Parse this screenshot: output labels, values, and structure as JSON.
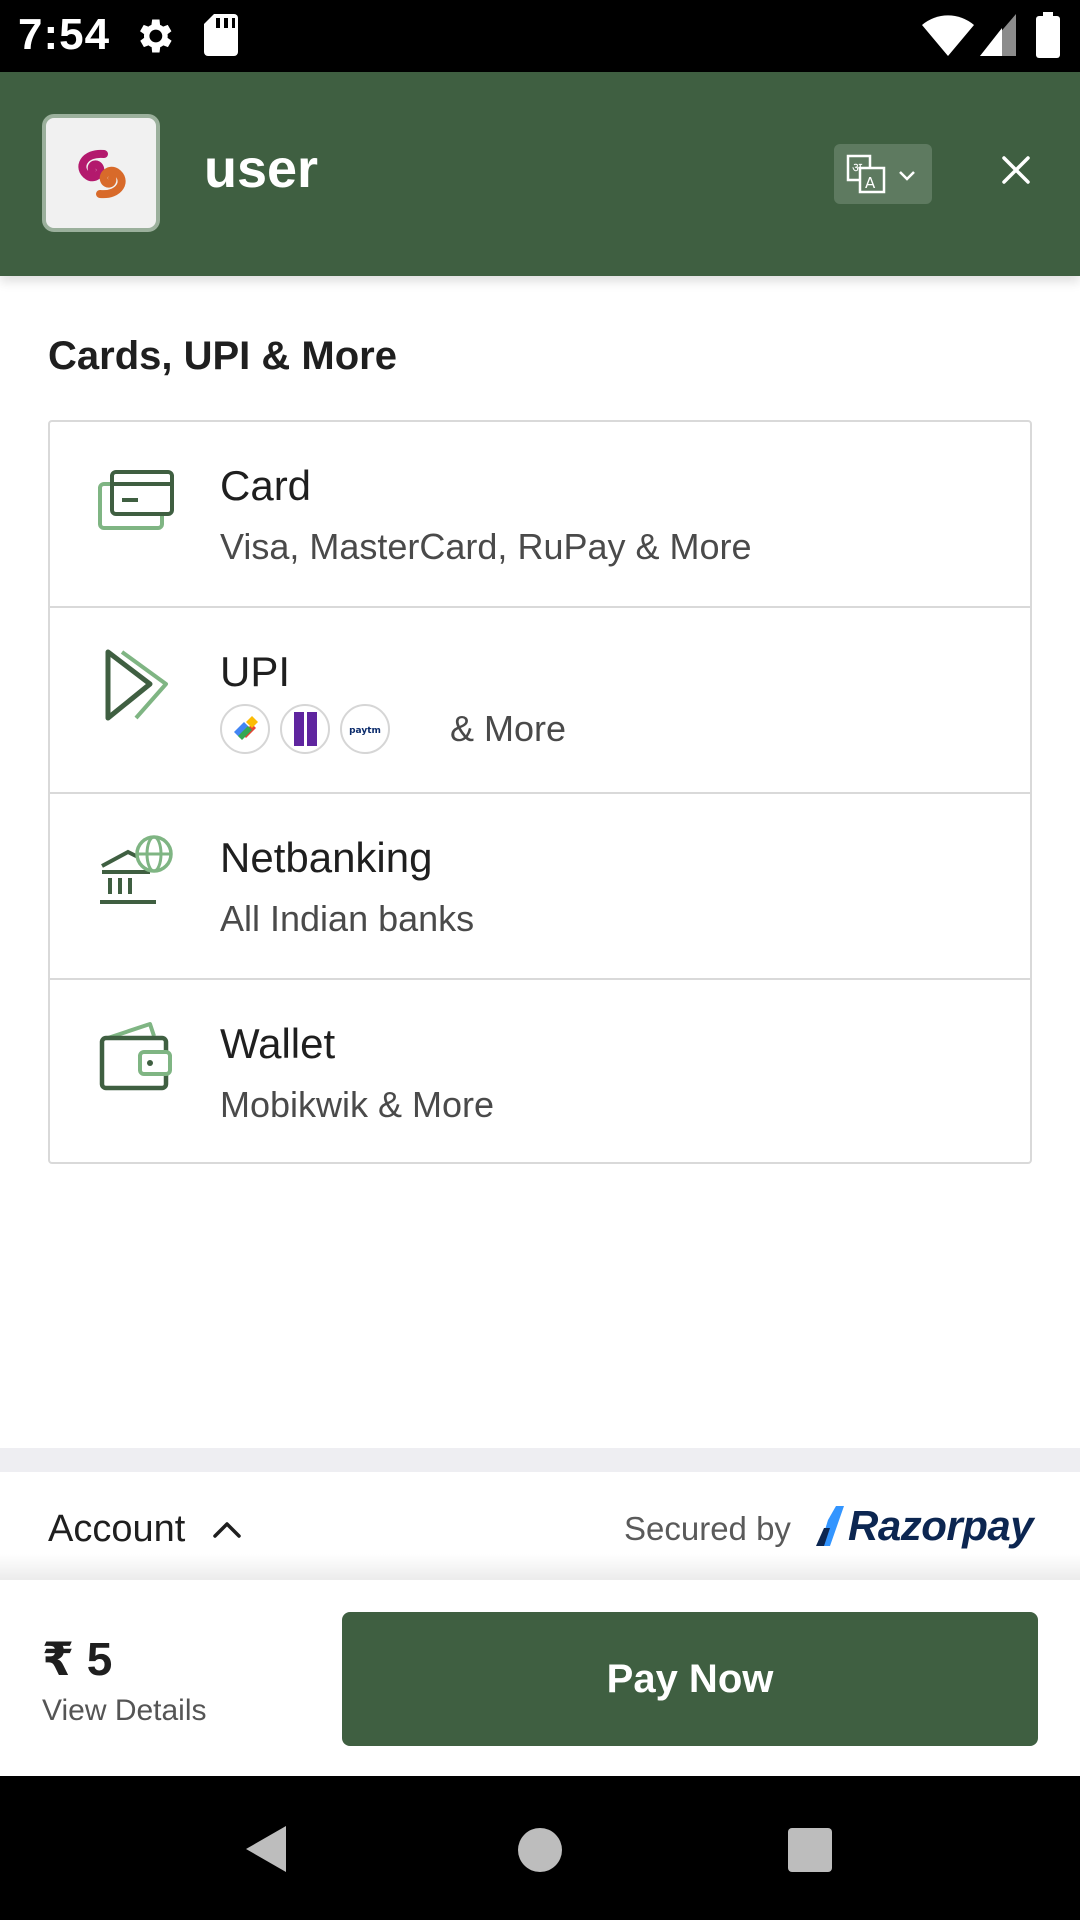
{
  "status_bar": {
    "time": "7:54",
    "icons": [
      "gear-icon",
      "sd-card-icon",
      "wifi-icon",
      "signal-icon",
      "battery-icon"
    ]
  },
  "header": {
    "merchant_name": "user",
    "logo_icon": "merchant-logo",
    "language_icon": "translate-icon",
    "close_icon": "close-icon",
    "background_color": "#3f5f41"
  },
  "section": {
    "title": "Cards, UPI & More"
  },
  "methods": [
    {
      "title": "Card",
      "subtitle": "Visa, MasterCard, RuPay & More",
      "icon": "card-icon"
    },
    {
      "title": "UPI",
      "subtitle": "& More",
      "icon": "upi-icon",
      "apps": [
        "google-pay-icon",
        "phonepe-icon",
        "paytm-icon"
      ],
      "paytm_label": "paytm"
    },
    {
      "title": "Netbanking",
      "subtitle": "All Indian banks",
      "icon": "bank-icon"
    },
    {
      "title": "Wallet",
      "subtitle": "Mobikwik & More",
      "icon": "wallet-icon"
    }
  ],
  "footer": {
    "account_label": "Account",
    "secured_by": "Secured by",
    "brand": "Razorpay"
  },
  "pay_bar": {
    "amount": "₹ 5",
    "view_details": "View Details",
    "pay_button": "Pay Now"
  },
  "nav_bar": {
    "icons": [
      "back-icon",
      "home-icon",
      "recents-icon"
    ]
  }
}
